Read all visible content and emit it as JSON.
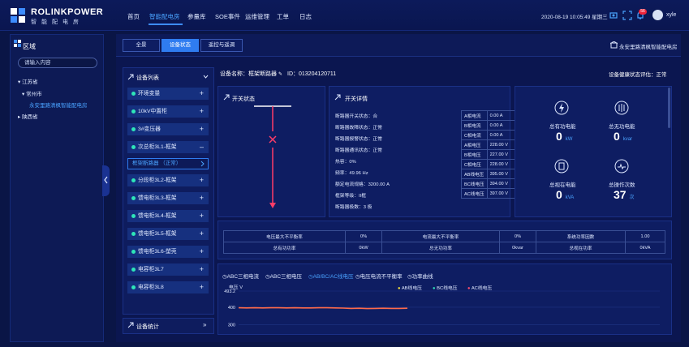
{
  "brand": {
    "name": "ROLINKPOWER",
    "sub": "智能配电房"
  },
  "nav": [
    "首页",
    "智能配电房",
    "参量库",
    "SOE事件",
    "运维管理",
    "工单",
    "日志"
  ],
  "header": {
    "datetime": "2020-08-19 10:05:49 星期三",
    "badge": "56",
    "user": "xyle"
  },
  "left": {
    "title": "区域",
    "search_placeholder": "请输入内容",
    "tree": [
      "▾ 江苏省",
      "▾ 常州市",
      "永安里路清枫智能配电房",
      "▸ 陕西省"
    ]
  },
  "tabs": [
    "全景",
    "设备状态",
    "遥控与遥调"
  ],
  "site_name": "永安里路清枫智能配电房",
  "device_list": {
    "title": "设备列表",
    "items": [
      "环境变量",
      "10kV中置柜",
      "3#变压器",
      "次总柜3L1-框架",
      "分段柜3L2-框架",
      "馈电柜3L3-框架",
      "馈电柜3L4-框架",
      "馈电柜3L5-框架",
      "馈电柜3L6-塑壳",
      "电容柜3L7",
      "电容柜3L8"
    ],
    "sub_item": "框架断路器 （正常）",
    "stats_title": "设备统计"
  },
  "device_head": {
    "name": "设备名称：框架断路器",
    "id": "ID：013204120711",
    "health": "设备健康状态评估：正常"
  },
  "switch_panel": {
    "title": "开关状态"
  },
  "detail_panel": {
    "title": "开关详情",
    "kv": [
      "断路器开关状态：合",
      "断路器故障状态：正常",
      "断路器报警状态：正常",
      "断路器通讯状态：正常",
      "热容：0%",
      "频率：49.96 Hz",
      "额定电流规格：3200.00 A",
      "框架等级：II框",
      "断路器极数：3 极"
    ],
    "table": [
      [
        "A相电流",
        "0.00 A"
      ],
      [
        "B相电流",
        "0.00 A"
      ],
      [
        "C相电流",
        "0.00 A"
      ],
      [
        "A相电压",
        "228.00 V"
      ],
      [
        "B相电压",
        "227.00 V"
      ],
      [
        "C相电压",
        "228.00 V"
      ],
      [
        "AB线电压",
        "395.00 V"
      ],
      [
        "BC线电压",
        "394.00 V"
      ],
      [
        "AC线电压",
        "397.00 V"
      ]
    ]
  },
  "stats": [
    {
      "label": "总有功电能",
      "value": "0",
      "unit": "kW"
    },
    {
      "label": "总无功电能",
      "value": "0",
      "unit": "kvar"
    },
    {
      "label": "总视在电能",
      "value": "0",
      "unit": "kVA"
    },
    {
      "label": "总操作次数",
      "value": "37",
      "unit": "次"
    }
  ],
  "summary": [
    [
      "电压最大不平衡率",
      "0%",
      "电流最大不平衡率",
      "0%",
      "系统功率因数",
      "1.00"
    ],
    [
      "总有功功率",
      "0kW",
      "总无功功率",
      "0kvar",
      "总视在功率",
      "0kVA"
    ]
  ],
  "chart_tabs": [
    "ABC三相电流",
    "ABC三相电压",
    "AB/BC/AC线电压",
    "电压电流不平衡率",
    "功率曲线"
  ],
  "chart_data": {
    "type": "line",
    "ylabel": "电压 V",
    "yticks": [
      "493.2",
      "400",
      "300"
    ],
    "legend": [
      "AB线电压",
      "BC线电压",
      "AC线电压"
    ],
    "series": [
      {
        "name": "AC线电压",
        "values": [
          397,
          396,
          397,
          396,
          397,
          397,
          396,
          397,
          396,
          396,
          397,
          397,
          396,
          395,
          393,
          394,
          392,
          393,
          394,
          393,
          393,
          394
        ]
      }
    ],
    "ylim": [
      250,
      493.2
    ],
    "colors": {
      "AB": "#f5e03a",
      "BC": "#2ee6b8",
      "AC": "#ff4d6d"
    }
  }
}
